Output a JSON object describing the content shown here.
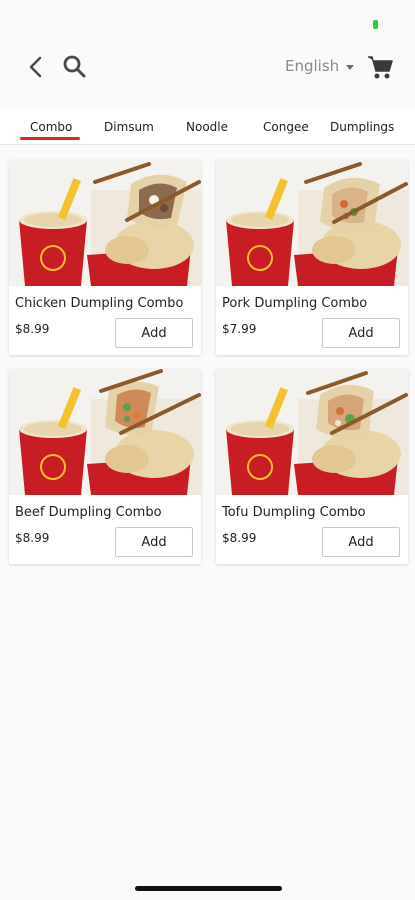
{
  "header": {
    "language": "English",
    "icons": [
      "back-icon",
      "search-icon",
      "caret-down-icon",
      "cart-icon"
    ]
  },
  "tabs": [
    {
      "label": "Combo",
      "active": true
    },
    {
      "label": "Dimsum",
      "active": false
    },
    {
      "label": "Noodle",
      "active": false
    },
    {
      "label": "Congee",
      "active": false
    },
    {
      "label": "Dumplings",
      "active": false
    }
  ],
  "products": [
    {
      "name": "Chicken Dumpling Combo",
      "price": "$8.99",
      "add_label": "Add"
    },
    {
      "name": "Pork Dumpling Combo",
      "price": "$7.99",
      "add_label": "Add"
    },
    {
      "name": "Beef Dumpling Combo",
      "price": "$8.99",
      "add_label": "Add"
    },
    {
      "name": "Tofu Dumpling Combo",
      "price": "$8.99",
      "add_label": "Add"
    }
  ],
  "colors": {
    "accent": "#d62828",
    "icon_gray": "#4a4a4a",
    "status_green": "#2ecc40"
  }
}
